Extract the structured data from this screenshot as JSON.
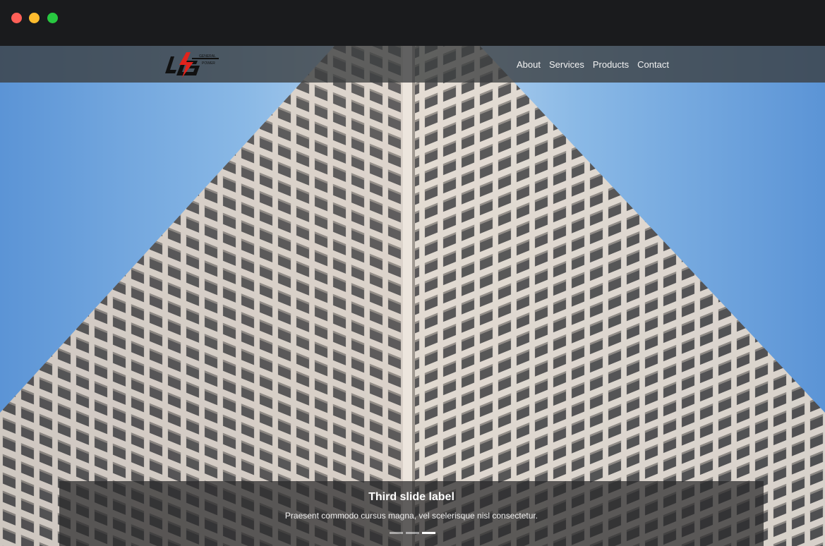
{
  "navbar": {
    "logo_alt": "General Power",
    "logo_text_top": "GENERAL",
    "logo_text_bottom": "POWER",
    "links": [
      {
        "label": "About"
      },
      {
        "label": "Services"
      },
      {
        "label": "Products"
      },
      {
        "label": "Contact"
      }
    ]
  },
  "carousel": {
    "caption_title": "Third slide label",
    "caption_text": "Praesent commodo cursus magna, vel scelerisque nisl consectetur.",
    "slide_count": 3,
    "active_index": 2
  },
  "colors": {
    "sky_top": "#9ec6ea",
    "sky_side": "#6fa5dd",
    "facade_light": "#e4d8cc",
    "facade_dark": "#3a3a3c",
    "logo_red": "#e0231c"
  }
}
